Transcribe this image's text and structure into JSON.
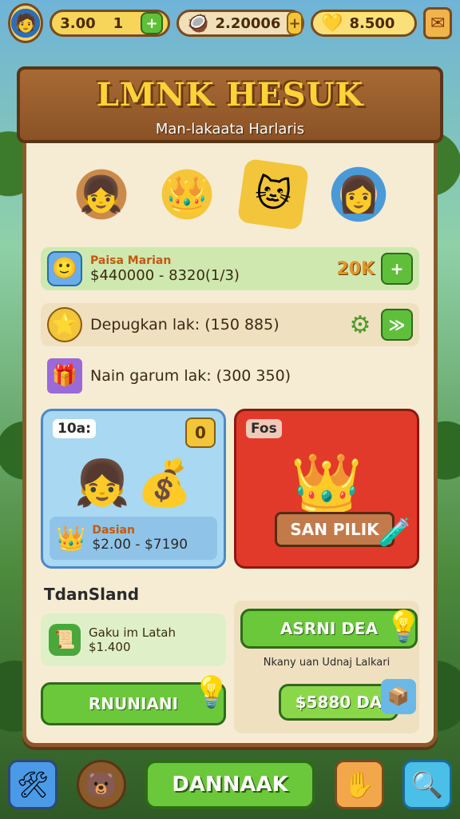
{
  "topbar": {
    "gold_value": "3.00",
    "gold_count": "1",
    "gold_plus": "+",
    "gem_value": "2.20006",
    "gem_plus": "+",
    "leaf_value": "8.500"
  },
  "header": {
    "title": "LMNK HESUK",
    "subtitle": "Man-lakaata Harlaris"
  },
  "rows": [
    {
      "title": "Paisa Marian",
      "value": "$440000 - 8320(1/3)",
      "badge": "20K",
      "action": "+"
    },
    {
      "text": "Depugkan lak:  (150 885)"
    },
    {
      "text": "Nain garum lak:  (300 350)"
    }
  ],
  "card_blue": {
    "tag": "10a:",
    "corner": "0",
    "footer_title": "Dasian",
    "footer_value": "$2.00 - $7190"
  },
  "card_red": {
    "tag": "Fos",
    "button": "SAN PILIK"
  },
  "section_label": "TdanSland",
  "bottom_left": {
    "line1": "Gaku im Latah",
    "line2": "$1.400",
    "button": "RNUNIANI"
  },
  "bottom_right": {
    "button": "ASRNI DEA",
    "description": "Nkany uan Udnaj Lalkari",
    "price_button": "$5880 DA"
  },
  "nav": {
    "main_button": "DANNAAK"
  },
  "colors": {
    "panel": "#f6ecd4",
    "wood": "#8a5226",
    "accent_green": "#6ac83a",
    "card_red": "#e23a2a",
    "card_blue": "#a8d8f2"
  }
}
